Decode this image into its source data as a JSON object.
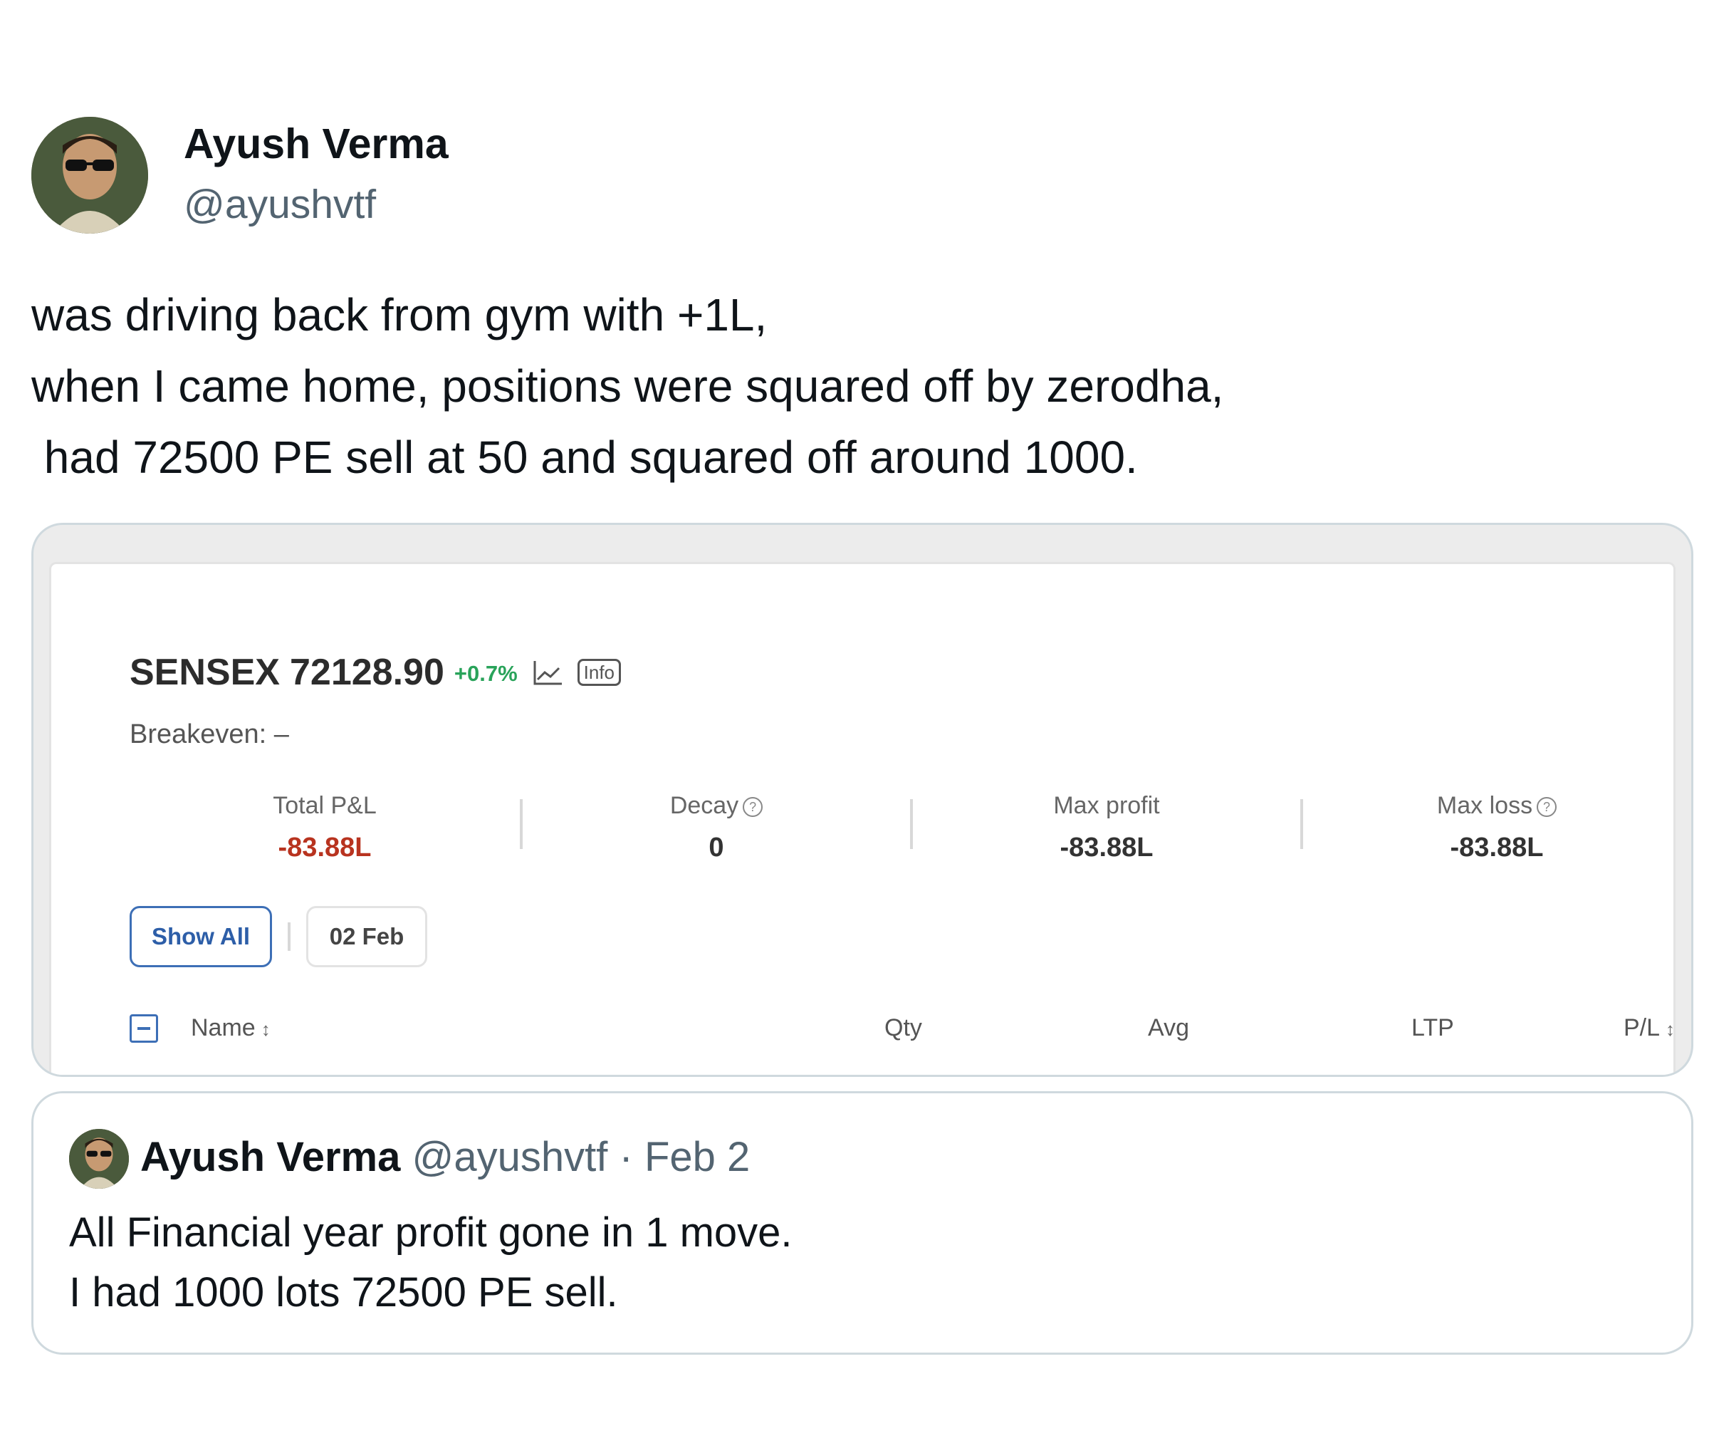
{
  "author": {
    "name": "Ayush Verma",
    "handle": "@ayushvtf"
  },
  "tweet": {
    "lines": [
      "was driving back from gym with +1L,",
      "when I came home, positions were squared off by zerodha,",
      " had 72500 PE sell at 50 and squared off around 1000."
    ]
  },
  "media": {
    "ticker": {
      "name": "SENSEX",
      "value": "72128.90",
      "change": "+0.7%",
      "info_label": "Info"
    },
    "breakeven": "Breakeven: –",
    "stats": [
      {
        "label": "Total P&L",
        "value": "-83.88L",
        "help": false
      },
      {
        "label": "Decay",
        "value": "0",
        "help": true
      },
      {
        "label": "Max profit",
        "value": "-83.88L",
        "help": false
      },
      {
        "label": "Max loss",
        "value": "-83.88L",
        "help": true
      }
    ],
    "filters": {
      "show_all": "Show All",
      "date": "02 Feb"
    },
    "table_headers": {
      "name": "Name",
      "qty": "Qty",
      "avg": "Avg",
      "ltp": "LTP",
      "pl": "P/L"
    },
    "colors": {
      "positive": "#29a35a",
      "negative": "#b8331f",
      "accent": "#3d6fb6"
    }
  },
  "quoted": {
    "name": "Ayush Verma",
    "handle": "@ayushvtf",
    "separator": "·",
    "date": "Feb 2",
    "lines": [
      "All Financial year profit gone in 1 move.",
      "I had 1000 lots 72500 PE sell."
    ]
  }
}
